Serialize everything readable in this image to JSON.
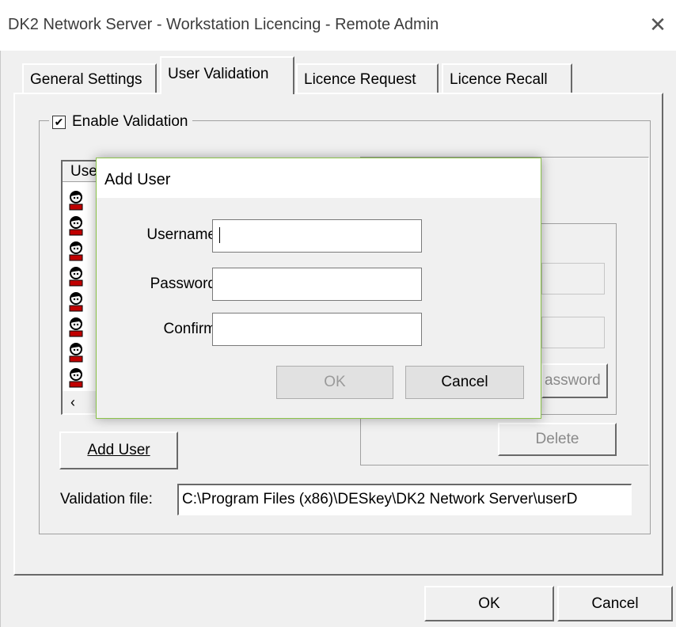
{
  "window": {
    "title": "DK2 Network Server - Workstation Licencing - Remote Admin"
  },
  "tabs": [
    {
      "label": "General Settings"
    },
    {
      "label": "User Validation"
    },
    {
      "label": "Licence Request"
    },
    {
      "label": "Licence Recall"
    }
  ],
  "validation": {
    "enable_label": "Enable Validation",
    "enable_checked": "✔",
    "list_header": "User",
    "add_user_label": "Add User",
    "add_user_mnemonic": "A",
    "delete_label": "Delete",
    "password_btn_label": "assword",
    "file_label": "Validation file:",
    "file_value": "C:\\Program Files (x86)\\DESkey\\DK2 Network Server\\userD"
  },
  "dialog": {
    "title": "Add User",
    "username_label": "Username",
    "password_label": "Password",
    "confirm_label": "Confirm",
    "ok_label": "OK",
    "cancel_label": "Cancel"
  },
  "footer": {
    "ok_label": "OK",
    "cancel_label": "Cancel"
  },
  "icons": [
    "close-icon",
    "user-icon",
    "chevron-left-icon",
    "checkbox-checked-icon"
  ],
  "colors": {
    "dialog_border": "#8bc34a",
    "face": "#f0f0f0"
  }
}
